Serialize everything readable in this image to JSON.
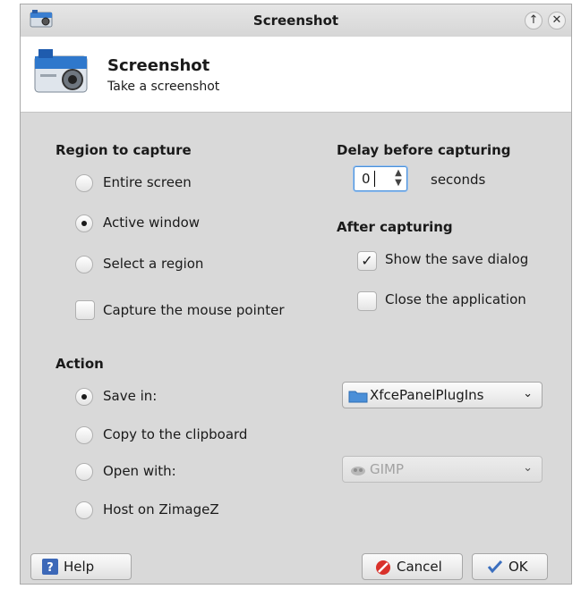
{
  "window": {
    "title": "Screenshot",
    "keep_above_label": "↑",
    "close_label": "✕"
  },
  "header": {
    "title": "Screenshot",
    "subtitle": "Take a screenshot"
  },
  "region": {
    "heading": "Region to capture",
    "options": [
      {
        "label": "Entire screen",
        "checked": false
      },
      {
        "label": "Active window",
        "checked": true
      },
      {
        "label": "Select a region",
        "checked": false
      }
    ],
    "mouse_pointer": {
      "label": "Capture the mouse pointer",
      "checked": false
    }
  },
  "delay": {
    "heading": "Delay before capturing",
    "value": "0",
    "unit": "seconds"
  },
  "after": {
    "heading": "After capturing",
    "show_save_dialog": {
      "label": "Show the save dialog",
      "checked": true
    },
    "close_application": {
      "label": "Close the application",
      "checked": false
    }
  },
  "action": {
    "heading": "Action",
    "options": [
      {
        "label": "Save in:",
        "checked": true
      },
      {
        "label": "Copy to the clipboard",
        "checked": false
      },
      {
        "label": "Open with:",
        "checked": false
      },
      {
        "label": "Host on ZimageZ",
        "checked": false
      }
    ],
    "save_folder": "XfcePanelPlugIns",
    "open_with_app": "GIMP"
  },
  "buttons": {
    "help": "Help",
    "cancel": "Cancel",
    "ok": "OK"
  },
  "colors": {
    "folder": "#4a8fd8",
    "cancel_icon": "#d9312a",
    "help_icon": "#3c68b8"
  }
}
